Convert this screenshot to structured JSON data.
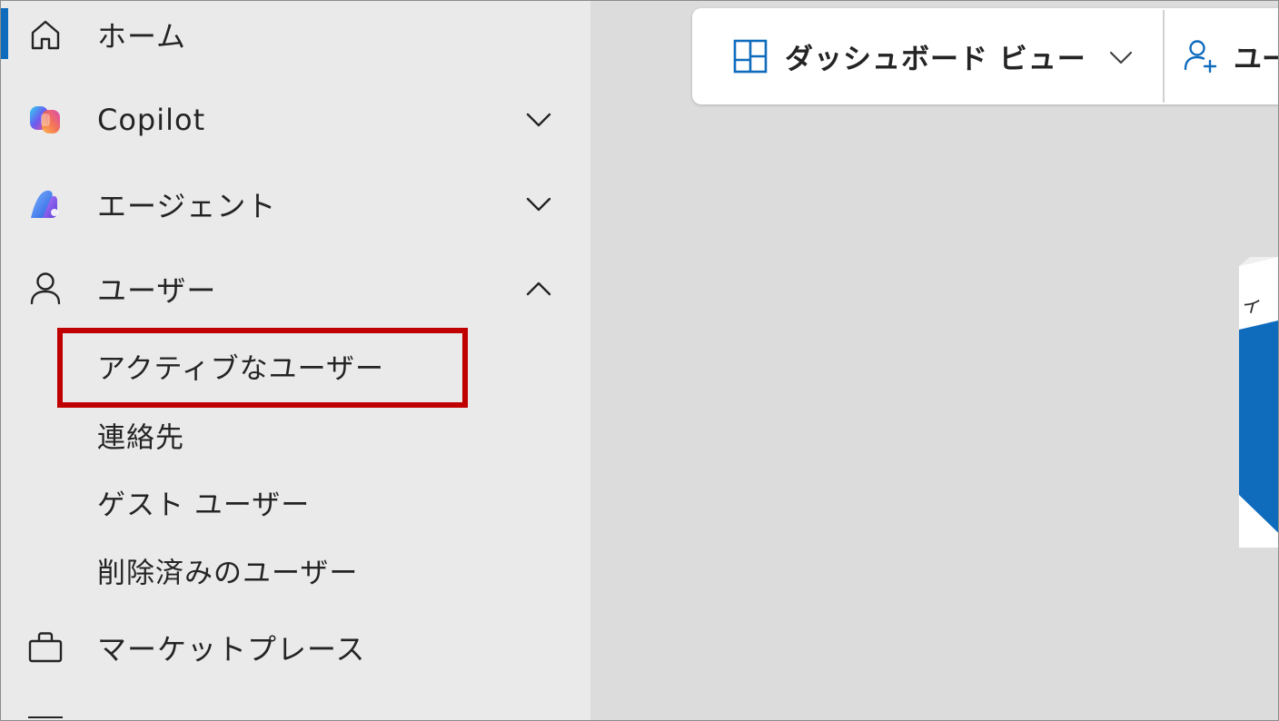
{
  "sidebar": {
    "items": [
      {
        "label": "ホーム",
        "icon": "home-icon",
        "active": true
      },
      {
        "label": "Copilot",
        "icon": "copilot-icon",
        "chevron": "chevron-down-icon"
      },
      {
        "label": "エージェント",
        "icon": "agents-icon",
        "chevron": "chevron-down-icon"
      },
      {
        "label": "ユーザー",
        "icon": "user-icon",
        "chevron": "chevron-up-icon",
        "expanded": true
      },
      {
        "label": "マーケットプレース",
        "icon": "shopping-bag-icon"
      }
    ],
    "users_subitems": [
      {
        "label": "アクティブなユーザー",
        "highlighted": true
      },
      {
        "label": "連絡先"
      },
      {
        "label": "ゲスト ユーザー"
      },
      {
        "label": "削除済みのユーザー"
      }
    ]
  },
  "toolbar": {
    "dashboard_view_label": "ダッシュボード ビュー",
    "dashboard_icon": "dashboard-icon",
    "add_user_label": "ユー",
    "add_user_icon": "add-user-icon"
  },
  "side_card": {
    "text": "イ"
  },
  "colors": {
    "accent": "#0f6cbd",
    "highlight_border": "#c00000",
    "sidebar_bg": "#eaeaea",
    "main_bg": "#dcdcdc"
  }
}
